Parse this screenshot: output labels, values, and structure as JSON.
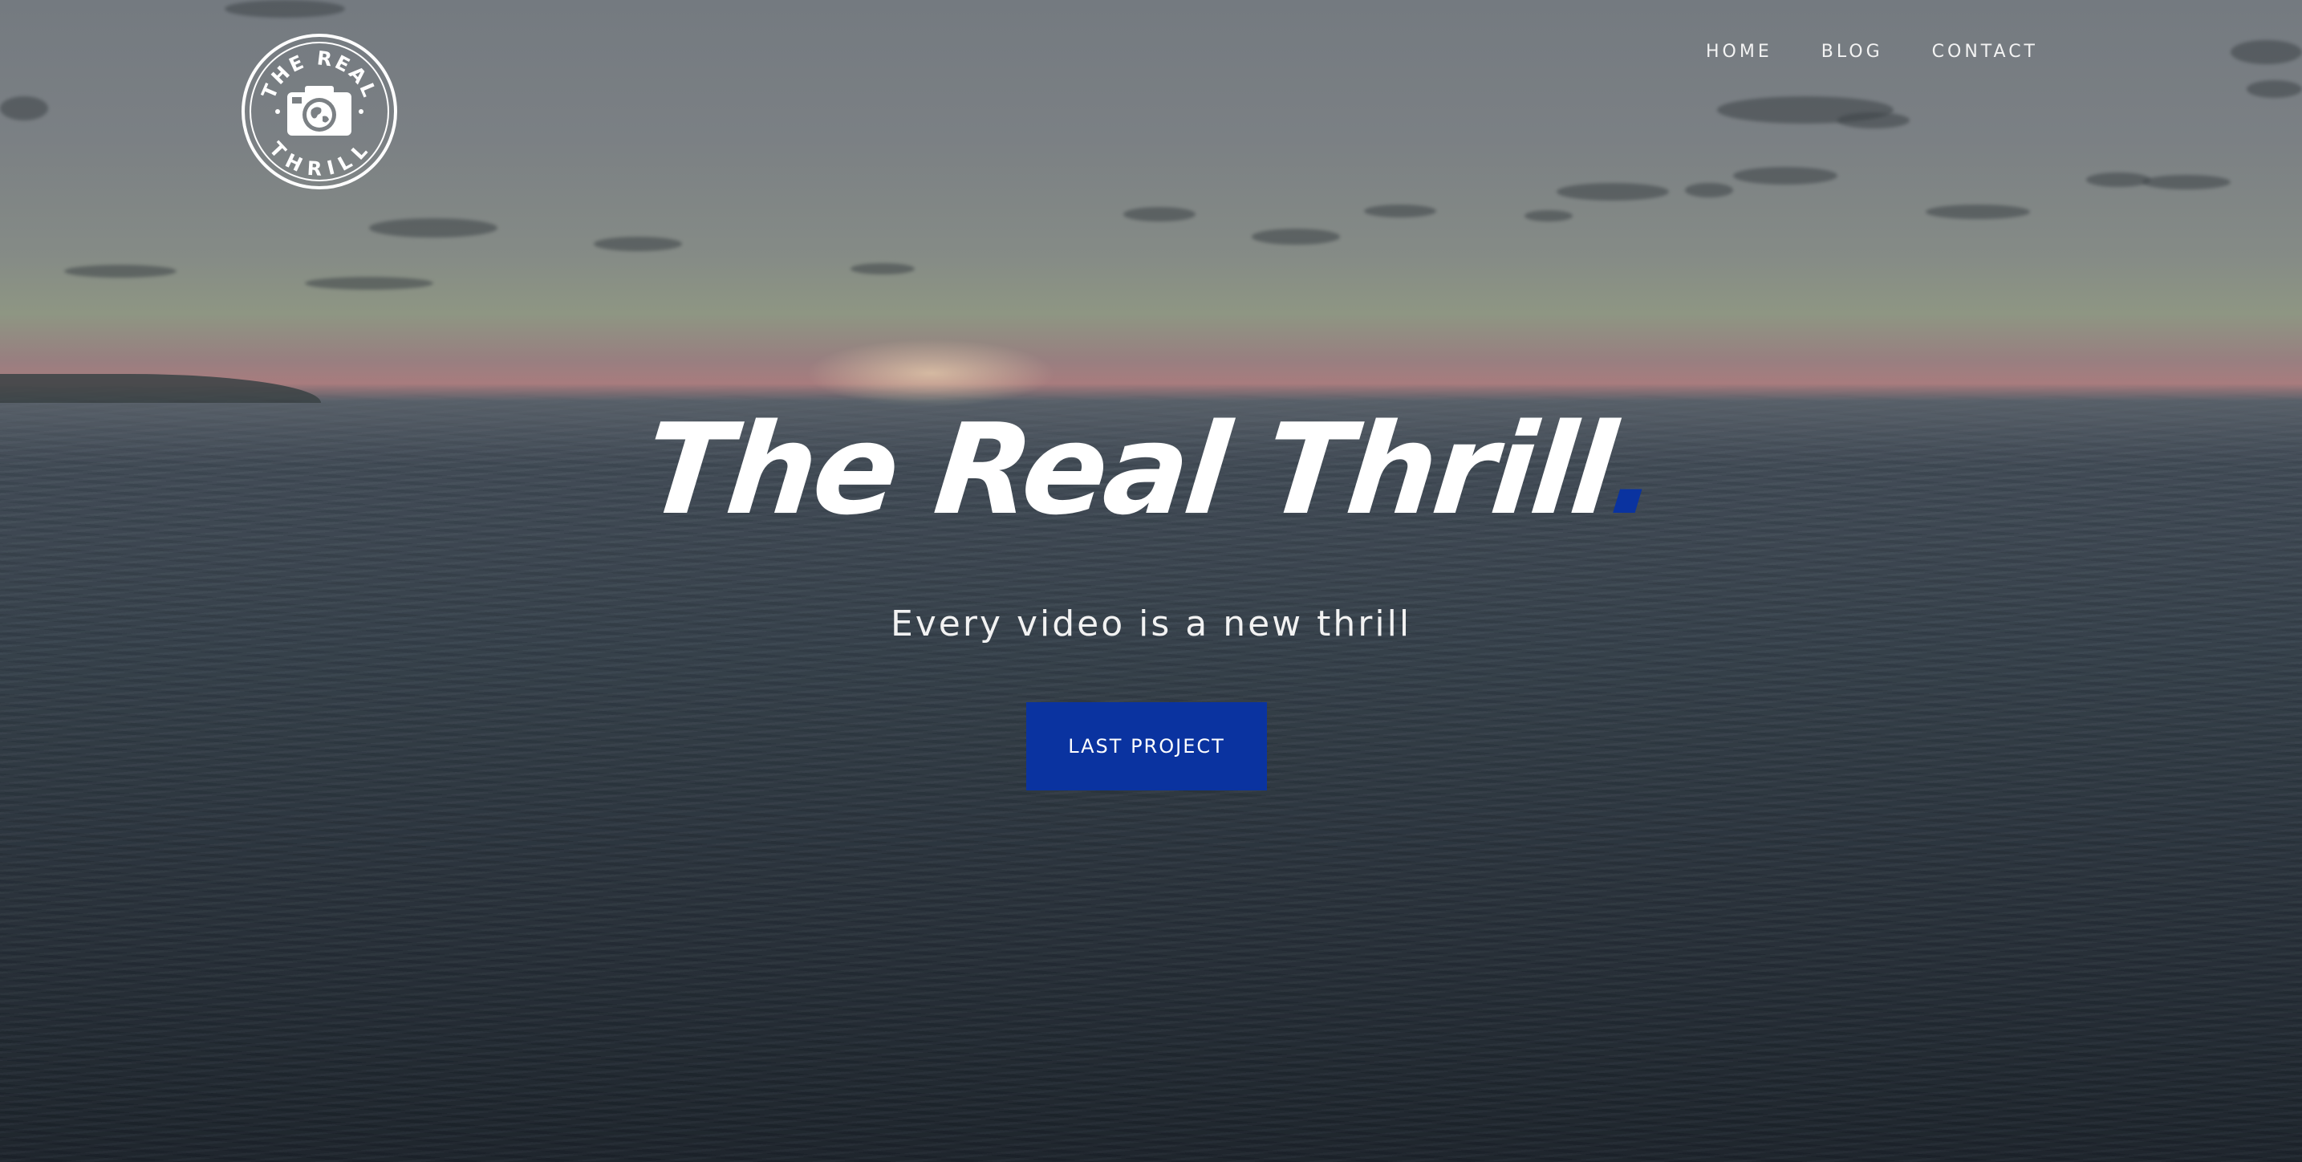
{
  "brand": {
    "logo_icon": "camera-globe-badge-icon",
    "logo_text_top": "THE REAL",
    "logo_text_bottom": "THRILL"
  },
  "nav": {
    "items": [
      {
        "label": "HOME"
      },
      {
        "label": "BLOG"
      },
      {
        "label": "CONTACT"
      }
    ]
  },
  "hero": {
    "title": "The Real Thrill",
    "title_dot": ".",
    "subtitle": "Every video is a new thrill",
    "cta_label": "LAST PROJECT"
  },
  "colors": {
    "accent": "#0a33a0",
    "text": "#ffffff"
  }
}
